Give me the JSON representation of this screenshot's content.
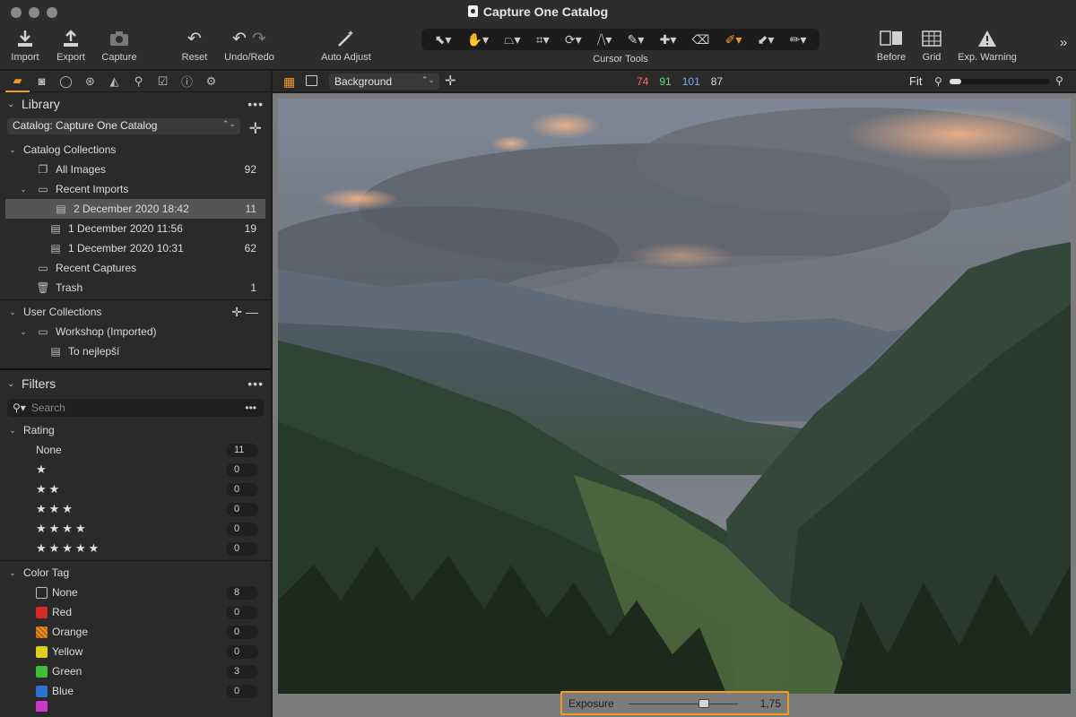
{
  "window": {
    "title": "Capture One Catalog"
  },
  "toolbar": {
    "import": "Import",
    "export": "Export",
    "capture": "Capture",
    "reset": "Reset",
    "undo_redo": "Undo/Redo",
    "auto_adjust": "Auto Adjust",
    "cursor_tools": "Cursor Tools",
    "before": "Before",
    "grid": "Grid",
    "exp_warning": "Exp. Warning",
    "cursor_tool_icons": [
      "select-icon",
      "pan-icon",
      "loupe-icon",
      "crop-icon",
      "rotate-icon",
      "keystone-icon",
      "brush-icon",
      "heal-icon",
      "eraser-icon",
      "picker-icon",
      "gradient-icon",
      "annotate-icon"
    ],
    "active_cursor_tool": "picker-icon"
  },
  "library": {
    "title": "Library",
    "catalog_select": "Catalog: Capture One Catalog",
    "catalog_collections": "Catalog Collections",
    "all_images": {
      "label": "All Images",
      "count": "92"
    },
    "recent_imports": "Recent Imports",
    "imports": [
      {
        "label": "2 December 2020 18:42",
        "count": "11",
        "selected": true
      },
      {
        "label": "1 December 2020 11:56",
        "count": "19"
      },
      {
        "label": "1 December 2020 10:31",
        "count": "62"
      }
    ],
    "recent_captures": "Recent Captures",
    "trash": {
      "label": "Trash",
      "count": "1"
    },
    "user_collections": "User Collections",
    "workshop": "Workshop (Imported)",
    "to_nejlepsi": "To nejlepší"
  },
  "filters": {
    "title": "Filters",
    "search_placeholder": "Search",
    "rating_title": "Rating",
    "ratings": [
      {
        "label": "None",
        "count": "11"
      },
      {
        "label": "★",
        "count": "0"
      },
      {
        "label": "★★",
        "count": "0"
      },
      {
        "label": "★★★",
        "count": "0"
      },
      {
        "label": "★★★★",
        "count": "0"
      },
      {
        "label": "★★★★★",
        "count": "0"
      }
    ],
    "color_tag_title": "Color Tag",
    "color_tags": [
      {
        "label": "None",
        "count": "8",
        "color": "none"
      },
      {
        "label": "Red",
        "count": "0",
        "color": "#d42a2a"
      },
      {
        "label": "Orange",
        "count": "0",
        "color": "#e88a1e"
      },
      {
        "label": "Yellow",
        "count": "0",
        "color": "#d9cf1c"
      },
      {
        "label": "Green",
        "count": "3",
        "color": "#3cbf3c"
      },
      {
        "label": "Blue",
        "count": "0",
        "color": "#3070d0"
      }
    ]
  },
  "viewer": {
    "layer": "Background",
    "rgb": {
      "r": "74",
      "g": "91",
      "b": "101",
      "l": "87"
    },
    "rgb_colors": {
      "r": "#ff6b6b",
      "g": "#6fdc6f",
      "b": "#7aa8ff",
      "l": "#d8d8d8"
    },
    "fit": "Fit",
    "zoom_level": 0.12
  },
  "exposure": {
    "label": "Exposure",
    "value": "1,75"
  },
  "colors": {
    "accent": "#f29a1f"
  }
}
